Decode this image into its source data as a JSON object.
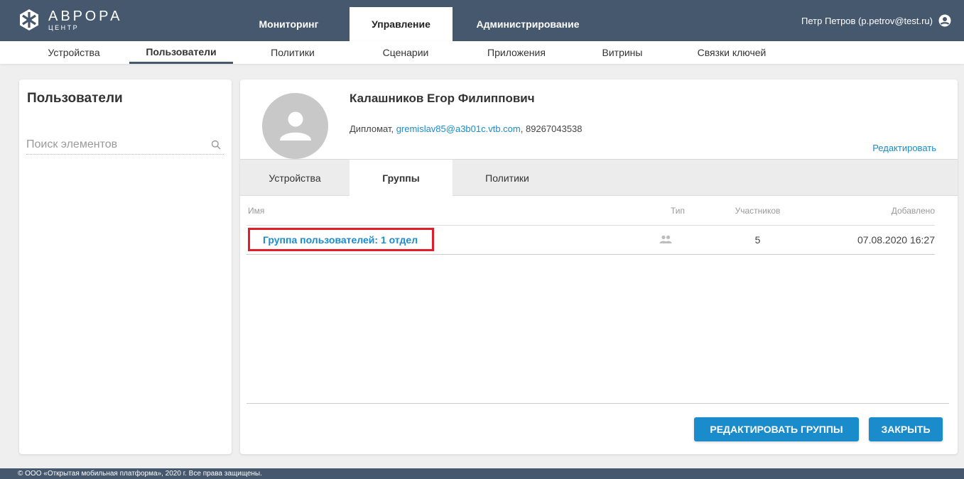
{
  "header": {
    "logo_big": "АВРОРА",
    "logo_small": "ЦЕНТР",
    "tabs": [
      "Мониторинг",
      "Управление",
      "Администрирование"
    ],
    "user": "Петр Петров (p.petrov@test.ru)"
  },
  "subnav": [
    "Устройства",
    "Пользователи",
    "Политики",
    "Сценарии",
    "Приложения",
    "Витрины",
    "Связки ключей"
  ],
  "sidebar": {
    "title": "Пользователи",
    "search_placeholder": "Поиск элементов"
  },
  "profile": {
    "name": "Калашников Егор Филиппович",
    "role": "Дипломат, ",
    "email": "gremislav85@a3b01c.vtb.com",
    "phone": ", 89267043538",
    "edit": "Редактировать"
  },
  "tabs": [
    "Устройства",
    "Группы",
    "Политики"
  ],
  "table": {
    "headers": [
      "Имя",
      "Тип",
      "Участников",
      "Добавлено"
    ],
    "rows": [
      {
        "name": "Группа пользователей: 1 отдел",
        "members": "5",
        "added": "07.08.2020 16:27"
      }
    ]
  },
  "buttons": {
    "edit_groups": "РЕДАКТИРОВАТЬ ГРУППЫ",
    "close": "ЗАКРЫТЬ"
  },
  "footer": "© ООО «Открытая мобильная платформа», 2020 г. Все права защищены."
}
